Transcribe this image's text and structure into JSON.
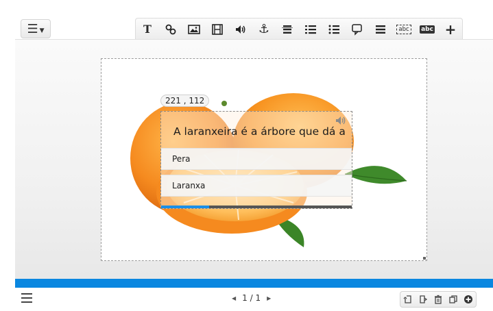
{
  "toolbar": {
    "menu_icon": "hamburger-menu-icon",
    "tools": [
      {
        "name": "text-tool",
        "icon": "text-T-icon"
      },
      {
        "name": "link-tool",
        "icon": "link-icon"
      },
      {
        "name": "image-tool",
        "icon": "image-icon"
      },
      {
        "name": "video-tool",
        "icon": "film-icon"
      },
      {
        "name": "audio-tool",
        "icon": "speaker-icon"
      },
      {
        "name": "anchor-tool",
        "icon": "anchor-icon"
      },
      {
        "name": "sort-tool",
        "icon": "sort-list-icon"
      },
      {
        "name": "ordered-list-tool",
        "icon": "numbered-list-icon"
      },
      {
        "name": "checklist-tool",
        "icon": "check-list-icon"
      },
      {
        "name": "popup-tool",
        "icon": "speech-bubble-icon"
      },
      {
        "name": "list-tool",
        "icon": "list-icon"
      },
      {
        "name": "fill-blank-tool",
        "icon": "abc-box-icon",
        "label": "abc"
      },
      {
        "name": "letter-tool",
        "icon": "abc-letters-icon",
        "label": "abc"
      },
      {
        "name": "add-tool",
        "icon": "plus-icon"
      }
    ]
  },
  "canvas": {
    "coordinates": "221 , 112",
    "quiz": {
      "question": "A laranxeira é a árbore que dá a",
      "answers": [
        "Pera",
        "Laranxa"
      ],
      "progress": 0.25
    }
  },
  "footer": {
    "page_indicator": "1 / 1",
    "prev_icon": "triangle-left-icon",
    "next_icon": "triangle-right-icon",
    "slide_tools": [
      "undo-page-icon",
      "add-page-icon",
      "trash-icon",
      "duplicate-icon",
      "plus-circle-icon"
    ]
  },
  "colors": {
    "accent": "#0a87e0",
    "progress": "#1a8fe8"
  }
}
